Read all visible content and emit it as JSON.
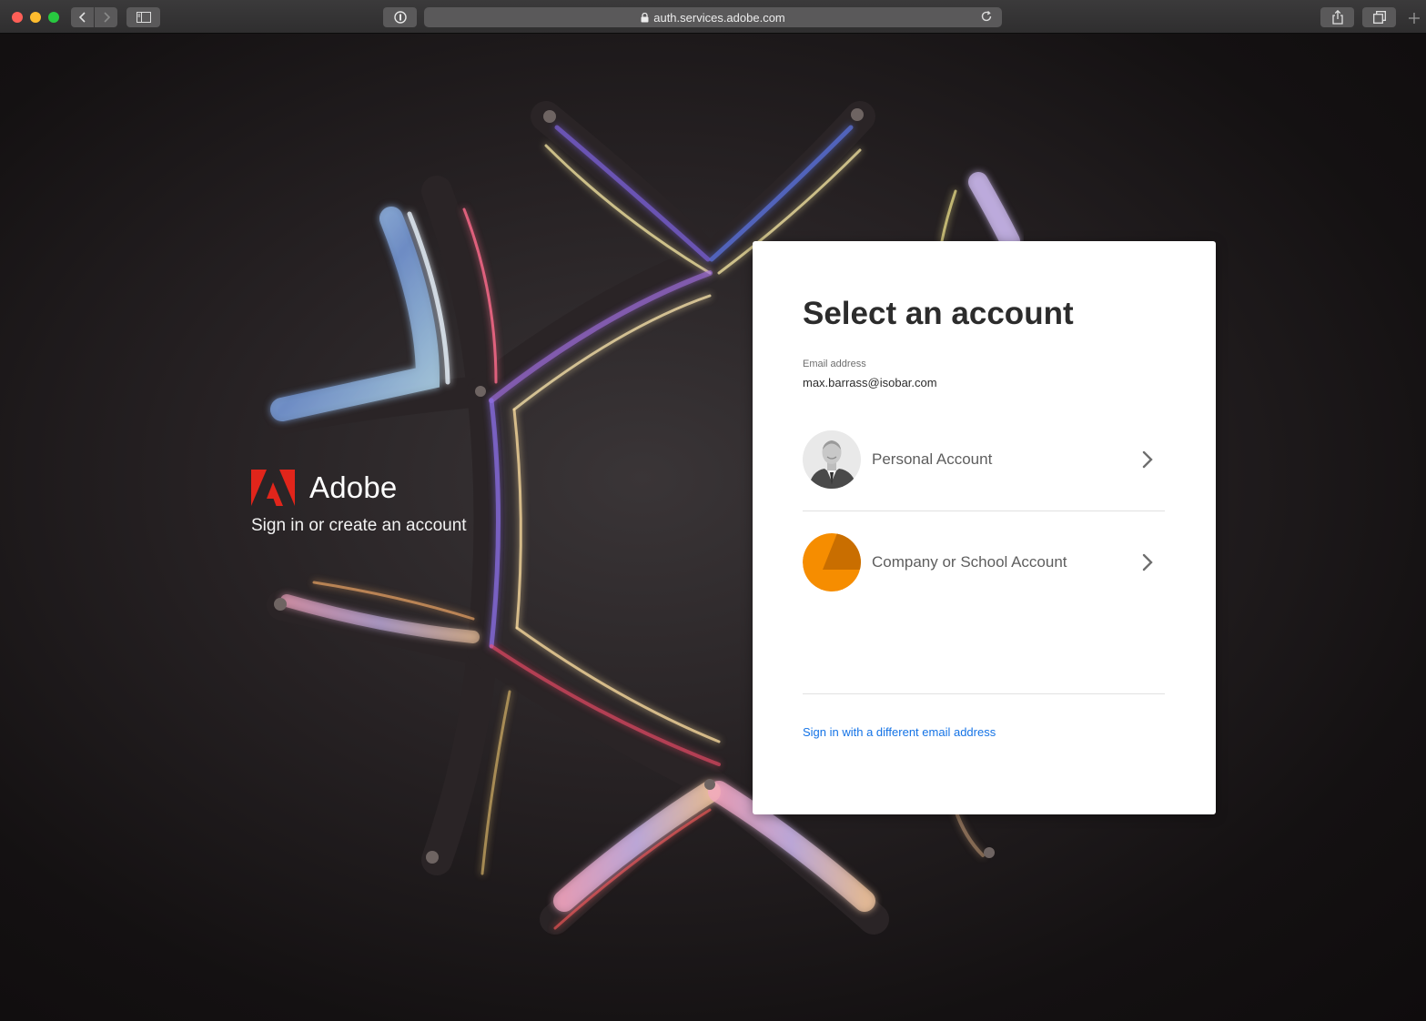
{
  "browser": {
    "url": "auth.services.adobe.com"
  },
  "brand": {
    "name": "Adobe",
    "tagline": "Sign in or create an account",
    "logo_color": "#e1251b"
  },
  "card": {
    "title": "Select an account",
    "email_label": "Email address",
    "email_value": "max.barrass@isobar.com",
    "accounts": [
      {
        "label": "Personal Account",
        "avatar": "user-photo"
      },
      {
        "label": "Company or School Account",
        "avatar": "orange-org-icon",
        "color": "#f68d00"
      }
    ],
    "alt_link": "Sign in with a different email address",
    "link_color": "#1473e6"
  }
}
